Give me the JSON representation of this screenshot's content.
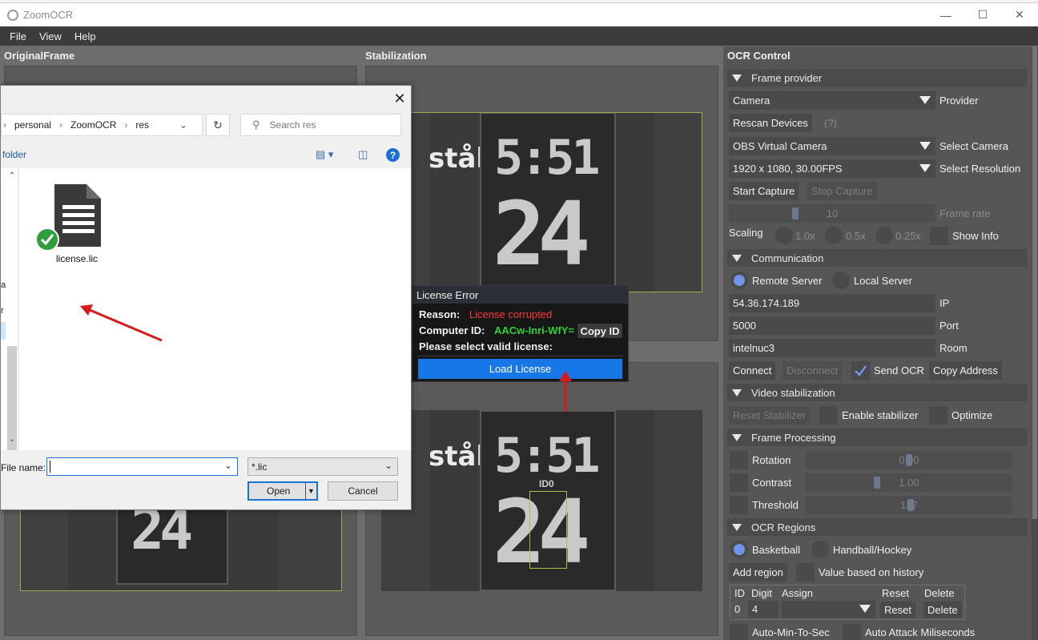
{
  "window": {
    "title": "ZoomOCR"
  },
  "menu": [
    "File",
    "View",
    "Help"
  ],
  "panels": {
    "original": "OriginalFrame",
    "stabilization": "Stabilization",
    "ocr": "OCR Control"
  },
  "scoreboard": {
    "time": "5:51",
    "shot": "24",
    "sponsor": "stål",
    "region_label": "ID0"
  },
  "license": {
    "title": "License Error",
    "reason_label": "Reason:",
    "reason_value": "License corrupted",
    "computer_id_label": "Computer ID:",
    "computer_id_value": "AACw-Inri-WfY=",
    "copy_button": "Copy ID",
    "prompt": "Please select valid license:",
    "load_button": "Load License"
  },
  "file_dialog": {
    "breadcrumb": [
      "personal",
      "ZoomOCR",
      "res"
    ],
    "search_placeholder": "Search res",
    "new_folder": "folder",
    "file": {
      "name": "license.lic"
    },
    "filename_label": "File name:",
    "filename_value": "",
    "filetype": "*.lic",
    "open_button": "Open",
    "cancel_button": "Cancel",
    "nav_letters": [
      "a",
      "r"
    ]
  },
  "ocr": {
    "frame_provider": {
      "section": "Frame provider",
      "provider_value": "Camera",
      "provider_label": "Provider",
      "rescan": "Rescan Devices",
      "help": "(?)",
      "camera_value": "OBS Virtual Camera",
      "camera_label": "Select Camera",
      "resolution_value": "1920 x 1080, 30.00FPS",
      "resolution_label": "Select Resolution",
      "start": "Start Capture",
      "stop": "Stop Capture",
      "framerate_value": "10",
      "framerate_label": "Frame rate",
      "scaling_label": "Scaling",
      "scales": [
        "1.0x",
        "0.5x",
        "0.25x"
      ],
      "show_info": "Show Info"
    },
    "communication": {
      "section": "Communication",
      "remote": "Remote Server",
      "local": "Local Server",
      "ip_value": "54.36.174.189",
      "ip_label": "IP",
      "port_value": "5000",
      "port_label": "Port",
      "room_value": "intelnuc3",
      "room_label": "Room",
      "connect": "Connect",
      "disconnect": "Disconnect",
      "send_ocr": "Send OCR",
      "copy_address": "Copy Address"
    },
    "video_stabilization": {
      "section": "Video stabilization",
      "reset": "Reset Stabilizer",
      "enable": "Enable stabilizer",
      "optimize": "Optimize"
    },
    "frame_processing": {
      "section": "Frame Processing",
      "rotation_label": "Rotation",
      "rotation_value": "0.00",
      "contrast_label": "Contrast",
      "contrast_value": "1.00",
      "threshold_label": "Threshold",
      "threshold_value": "127"
    },
    "ocr_regions": {
      "section": "OCR Regions",
      "basketball": "Basketball",
      "handball": "Handball/Hockey",
      "add_region": "Add region",
      "history": "Value based on history",
      "columns": [
        "ID",
        "Digit",
        "Assign",
        "Reset",
        "Delete"
      ],
      "row": {
        "id": "0",
        "digit": "4",
        "reset": "Reset",
        "delete": "Delete"
      },
      "auto_min": "Auto-Min-To-Sec",
      "auto_attack": "Auto Attack Miliseconds"
    }
  },
  "colors": {
    "accent": "#1877e6",
    "error": "#ff3a3a",
    "ok": "#2fd23a",
    "panel": "#565656"
  }
}
